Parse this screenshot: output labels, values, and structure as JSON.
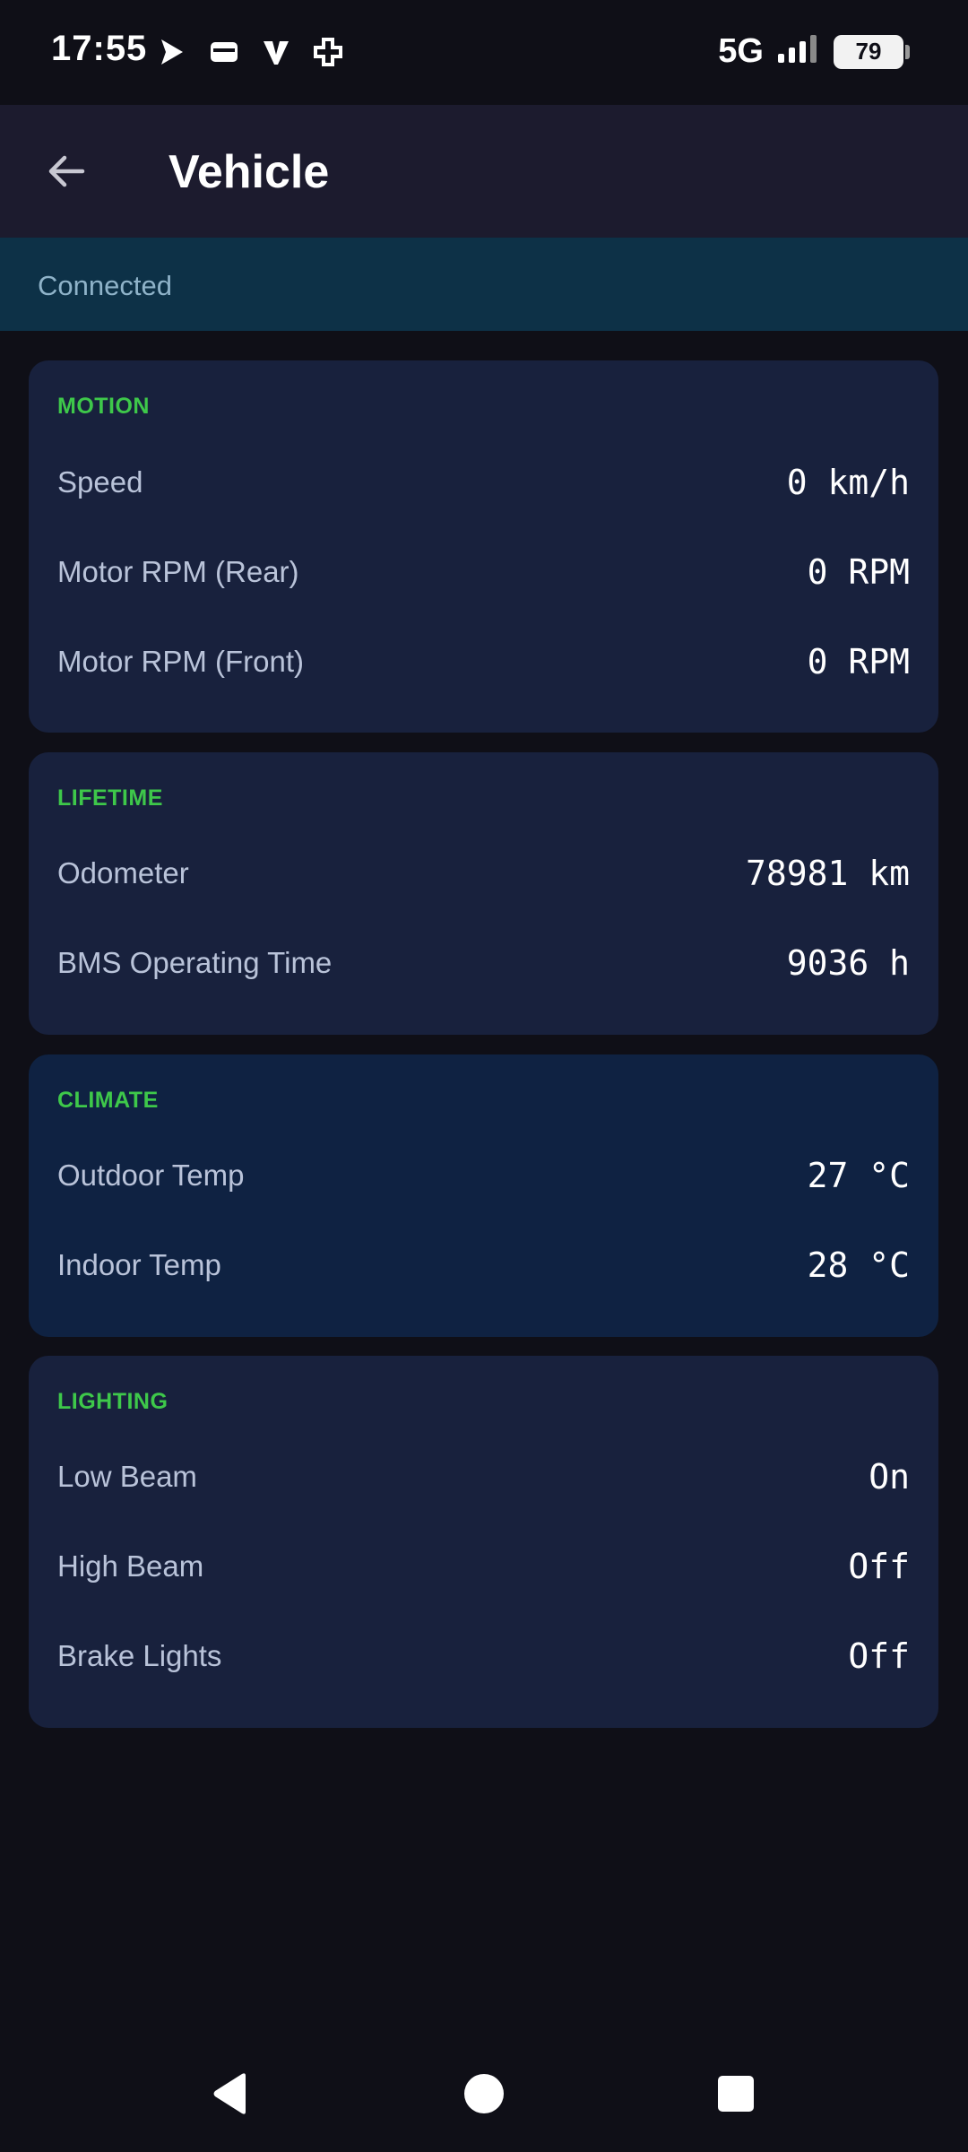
{
  "status_bar": {
    "time": "17:55",
    "network": "5G",
    "battery": "79",
    "notification_icons": [
      "play-store-icon",
      "wallet-icon",
      "v-app-icon",
      "medical-plus-icon"
    ]
  },
  "header": {
    "title": "Vehicle"
  },
  "connection": {
    "status": "Connected"
  },
  "sections": {
    "motion": {
      "title": "MOTION",
      "rows": [
        {
          "label": "Speed",
          "value": "0 km/h"
        },
        {
          "label": "Motor RPM (Rear)",
          "value": "0 RPM"
        },
        {
          "label": "Motor RPM (Front)",
          "value": "0 RPM"
        }
      ]
    },
    "lifetime": {
      "title": "LIFETIME",
      "rows": [
        {
          "label": "Odometer",
          "value": "78981 km"
        },
        {
          "label": "BMS Operating Time",
          "value": "9036 h"
        }
      ]
    },
    "climate": {
      "title": "CLIMATE",
      "rows": [
        {
          "label": "Outdoor Temp",
          "value": "27 °C"
        },
        {
          "label": "Indoor Temp",
          "value": "28 °C"
        }
      ]
    },
    "lighting": {
      "title": "LIGHTING",
      "rows": [
        {
          "label": "Low Beam",
          "value": "On"
        },
        {
          "label": "High Beam",
          "value": "Off"
        },
        {
          "label": "Brake Lights",
          "value": "Off"
        }
      ]
    }
  },
  "colors": {
    "background": "#0f0f17",
    "toolbar": "#1c1b2e",
    "banner": "#0d3147",
    "card": "#18213d",
    "card_climate": "#0f2242",
    "section_header": "#3ec84a"
  }
}
